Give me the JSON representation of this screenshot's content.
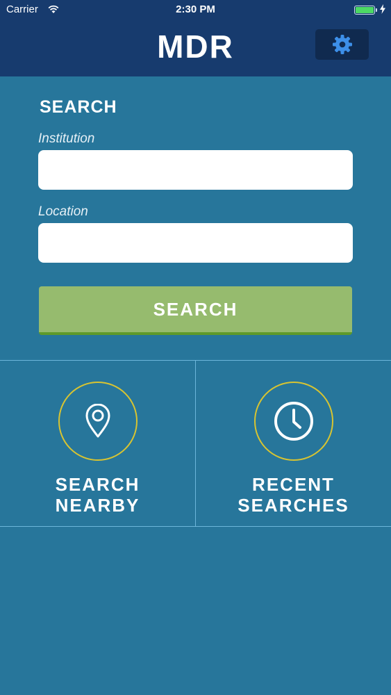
{
  "status_bar": {
    "carrier": "Carrier",
    "time": "2:30 PM",
    "battery_color": "#4cd964"
  },
  "nav": {
    "title": "MDR",
    "settings_icon": "gear-icon",
    "settings_icon_color": "#3d8fe8"
  },
  "search": {
    "heading": "SEARCH",
    "institution_label": "Institution",
    "institution_value": "",
    "location_label": "Location",
    "location_value": "",
    "button_label": "SEARCH",
    "button_color": "#96bb6e"
  },
  "quick_actions": [
    {
      "icon": "location-pin-icon",
      "line1": "SEARCH",
      "line2": "NEARBY"
    },
    {
      "icon": "clock-icon",
      "line1": "RECENT",
      "line2": "SEARCHES"
    }
  ],
  "colors": {
    "background": "#27769b",
    "header": "#173b6e",
    "ring": "#d8c431"
  }
}
